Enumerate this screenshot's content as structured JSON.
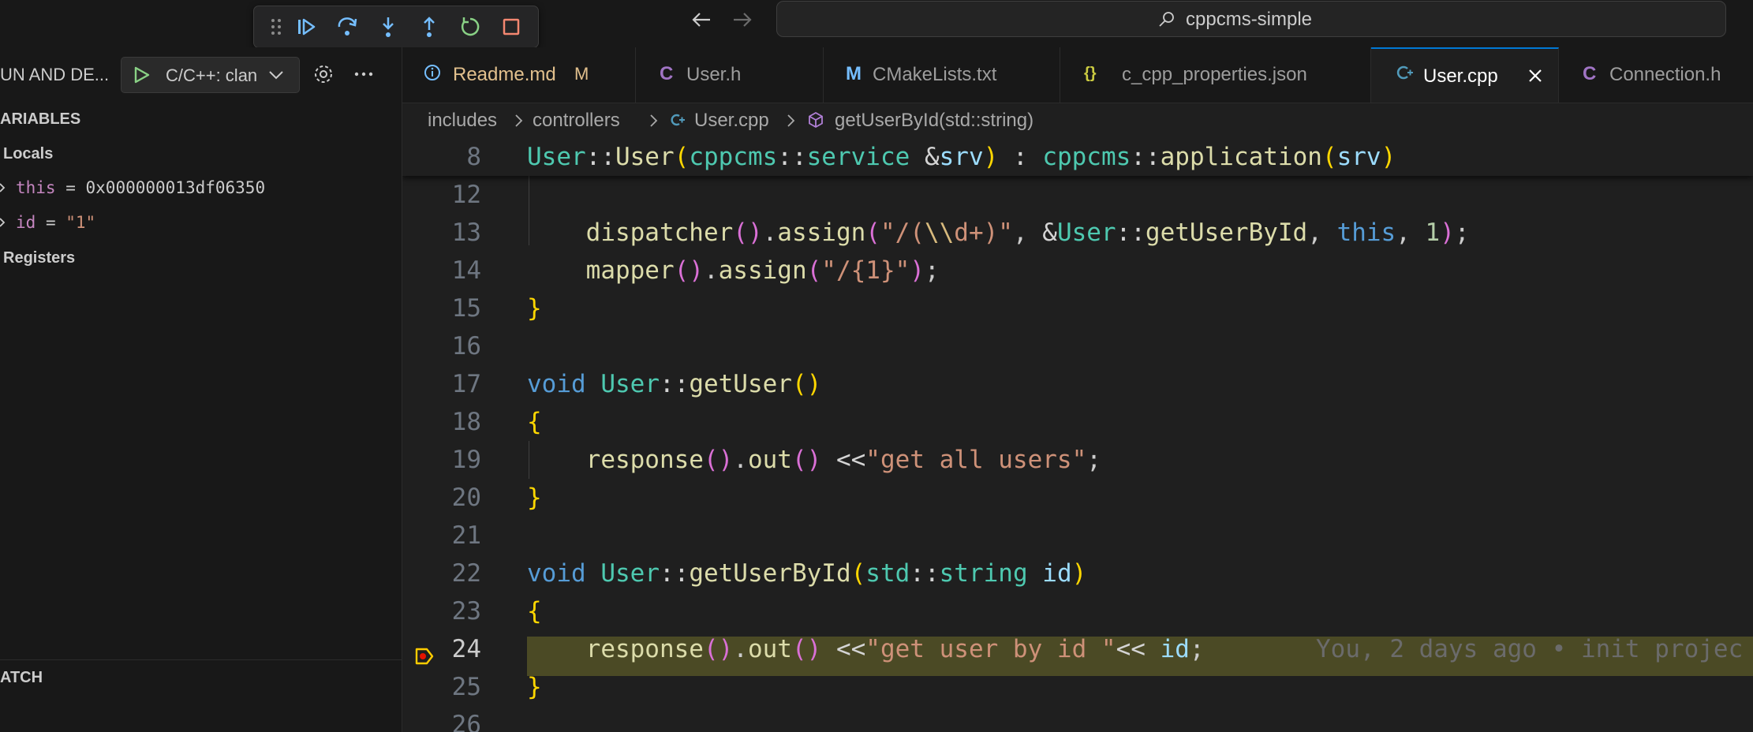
{
  "colors": {
    "accent": "#0078d4",
    "bg": "#1f1f1f",
    "sidebar_bg": "#181818",
    "debug_line": "#4b4a25"
  },
  "titlebar": {
    "command_center": "cppcms-simple",
    "debug_toolbar": [
      "drag-handle-icon",
      "continue-icon",
      "step-over-icon",
      "step-into-icon",
      "step-out-icon",
      "restart-icon",
      "stop-icon"
    ]
  },
  "sidebar": {
    "title": "UN AND DE...",
    "run_config": "C/C++: clan",
    "variables_header": "ARIABLES",
    "locals_header": "Locals",
    "vars": [
      {
        "name": "this",
        "eq": " = ",
        "value": "0x000000013df06350"
      },
      {
        "name": "id",
        "eq": " = ",
        "value": "\"1\""
      }
    ],
    "registers_header": "Registers",
    "watch_header": "ATCH"
  },
  "tabs": [
    {
      "icon": "info-icon",
      "label": "Readme.md",
      "badge": "M"
    },
    {
      "icon": "c-letter-icon",
      "label": "User.h"
    },
    {
      "icon": "m-letter-icon",
      "label": "CMakeLists.txt"
    },
    {
      "icon": "braces-icon",
      "label": "c_cpp_properties.json"
    },
    {
      "icon": "cpp-icon",
      "label": "User.cpp",
      "active": true
    },
    {
      "icon": "c-letter-icon",
      "label": "Connection.h"
    }
  ],
  "breadcrumb": [
    "includes",
    "controllers",
    "User.cpp",
    "getUserById(std::string)"
  ],
  "editor": {
    "sticky_line": "8",
    "line_numbers": [
      "12",
      "13",
      "14",
      "15",
      "16",
      "17",
      "18",
      "19",
      "20",
      "21",
      "22",
      "23",
      "24",
      "25",
      "26"
    ],
    "current_line": "24",
    "blame": "You, 2 days ago • init projec"
  }
}
